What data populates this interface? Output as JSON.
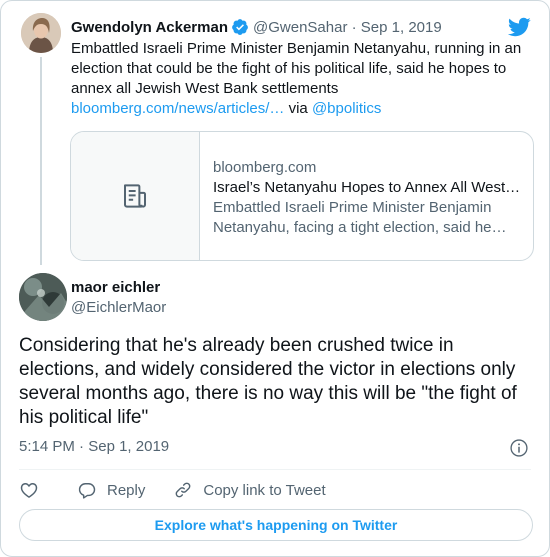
{
  "parent_tweet": {
    "author_name": "Gwendolyn Ackerman",
    "author_handle": "@GwenSahar",
    "separator": " · ",
    "date": "Sep 1, 2019",
    "text": "Embattled Israeli Prime Minister Benjamin Netanyahu, running in an election that could be the fight of his political life, said he hopes to annex all Jewish West Bank settlements",
    "link_text": "bloomberg.com/news/articles/…",
    "via_text": " via ",
    "via_handle": "@bpolitics",
    "card": {
      "domain": "bloomberg.com",
      "title": "Israel’s Netanyahu Hopes to Annex All West Bank Settlements",
      "description": "Embattled Israeli Prime Minister Benjamin Netanyahu, facing a tight election, said he hopes to annex all Jewish West Bank settlements"
    }
  },
  "main_tweet": {
    "author_name": "maor eichler",
    "author_handle": "@EichlerMaor",
    "text": "Considering that he's already been crushed twice in elections, and widely considered the victor in elections only several months ago, there is no way this will be \"the fight of his political life\"",
    "time": "5:14 PM",
    "separator": " · ",
    "date": "Sep 1, 2019"
  },
  "actions": {
    "reply_label": "Reply",
    "copy_link_label": "Copy link to Tweet"
  },
  "explore_label": "Explore what's happening on Twitter",
  "colors": {
    "accent": "#1d9bf0",
    "text": "#0f1419",
    "secondary": "#536471",
    "border": "#cfd9de"
  }
}
